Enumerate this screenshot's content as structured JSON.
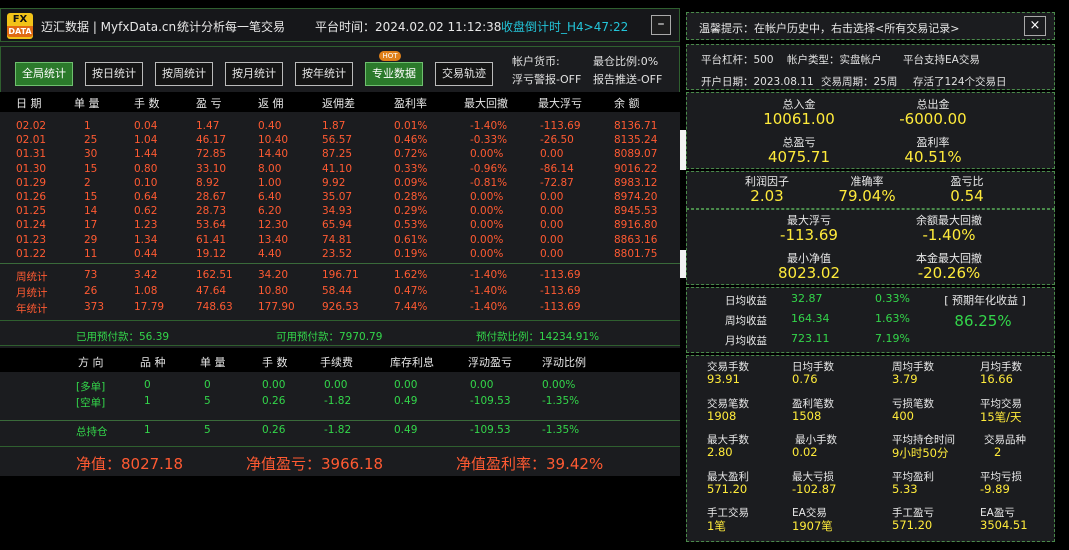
{
  "header": {
    "logo_top": "FX",
    "logo_bottom": "DATA",
    "brand": "迈汇数据 | MyfxData.cn",
    "slogan": "统计分析每一笔交易",
    "platform_time": "平台时间：2024.02.02 11:12:38",
    "countdown": "收盘倒计时_H4>47:22",
    "minimize": "–"
  },
  "toolbar": {
    "buttons": [
      "全局统计",
      "按日统计",
      "按周统计",
      "按月统计",
      "按年统计",
      "专业数据",
      "交易轨迹"
    ],
    "hot_badge": "HOT",
    "account_currency": "帐户货币:",
    "float_alert": "浮亏警报-OFF",
    "max_position": "最仓比例:0%",
    "report_push": "报告推送-OFF"
  },
  "daily_table": {
    "headers": [
      "日 期",
      "单 量",
      "手 数",
      "盈 亏",
      "返 佣",
      "返佣差",
      "盈利率",
      "最大回撤",
      "最大浮亏",
      "余 额"
    ],
    "rows": [
      [
        "02.02",
        "1",
        "0.04",
        "1.47",
        "0.40",
        "1.87",
        "0.01%",
        "-1.40%",
        "-113.69",
        "8136.71"
      ],
      [
        "02.01",
        "25",
        "1.04",
        "46.17",
        "10.40",
        "56.57",
        "0.46%",
        "-0.33%",
        "-26.50",
        "8135.24"
      ],
      [
        "01.31",
        "30",
        "1.44",
        "72.85",
        "14.40",
        "87.25",
        "0.72%",
        "0.00%",
        "0.00",
        "8089.07"
      ],
      [
        "01.30",
        "15",
        "0.80",
        "33.10",
        "8.00",
        "41.10",
        "0.33%",
        "-0.96%",
        "-86.14",
        "9016.22"
      ],
      [
        "01.29",
        "2",
        "0.10",
        "8.92",
        "1.00",
        "9.92",
        "0.09%",
        "-0.81%",
        "-72.87",
        "8983.12"
      ],
      [
        "01.26",
        "15",
        "0.64",
        "28.67",
        "6.40",
        "35.07",
        "0.28%",
        "0.00%",
        "0.00",
        "8974.20"
      ],
      [
        "01.25",
        "14",
        "0.62",
        "28.73",
        "6.20",
        "34.93",
        "0.29%",
        "0.00%",
        "0.00",
        "8945.53"
      ],
      [
        "01.24",
        "17",
        "1.23",
        "53.64",
        "12.30",
        "65.94",
        "0.53%",
        "0.00%",
        "0.00",
        "8916.80"
      ],
      [
        "01.23",
        "29",
        "1.34",
        "61.41",
        "13.40",
        "74.81",
        "0.61%",
        "0.00%",
        "0.00",
        "8863.16"
      ],
      [
        "01.22",
        "11",
        "0.44",
        "19.12",
        "4.40",
        "23.52",
        "0.19%",
        "0.00%",
        "0.00",
        "8801.75"
      ]
    ],
    "summary": [
      [
        "周统计",
        "73",
        "3.42",
        "162.51",
        "34.20",
        "196.71",
        "1.62%",
        "-1.40%",
        "-113.69"
      ],
      [
        "月统计",
        "26",
        "1.08",
        "47.64",
        "10.80",
        "58.44",
        "0.47%",
        "-1.40%",
        "-113.69"
      ],
      [
        "年统计",
        "373",
        "17.79",
        "748.63",
        "177.90",
        "926.53",
        "7.44%",
        "-1.40%",
        "-113.69"
      ]
    ]
  },
  "funds": {
    "used": "已用预付款：56.39",
    "available": "可用预付款：7970.79",
    "ratio": "预付款比例：14234.91%"
  },
  "positions": {
    "headers": [
      "方 向",
      "品 种",
      "单 量",
      "手 数",
      "手续费",
      "库存利息",
      "浮动盈亏",
      "浮动比例"
    ],
    "rows": [
      [
        "[多单]",
        "0",
        "0",
        "0.00",
        "0.00",
        "0.00",
        "0.00",
        "0.00%"
      ],
      [
        "[空单]",
        "1",
        "5",
        "0.26",
        "-1.82",
        "0.49",
        "-109.53",
        "-1.35%"
      ],
      [
        "总持仓",
        "1",
        "5",
        "0.26",
        "-1.82",
        "0.49",
        "-109.53",
        "-1.35%"
      ]
    ]
  },
  "net": {
    "equity": "净值：8027.18",
    "equity_pl": "净值盈亏：3966.18",
    "equity_rate": "净值盈利率：39.42%"
  },
  "right": {
    "tip": "温馨提示：在帐户历史中，右击选择<所有交易记录>",
    "close": "×",
    "info1": [
      "平台杠杆：500",
      "帐户类型：实盘帐户",
      "平台支持EA交易"
    ],
    "info2": [
      "开户日期：2023.08.11",
      "交易周期：25周",
      "存活了124个交易日"
    ],
    "block1": [
      {
        "label": "总入金",
        "value": "10061.00"
      },
      {
        "label": "总出金",
        "value": "-6000.00"
      },
      {
        "label": "总盈亏",
        "value": "4075.71"
      },
      {
        "label": "盈利率",
        "value": "40.51%"
      }
    ],
    "block2": [
      {
        "label": "利润因子",
        "value": "2.03"
      },
      {
        "label": "准确率",
        "value": "79.04%"
      },
      {
        "label": "盈亏比",
        "value": "0.54"
      }
    ],
    "block3": [
      {
        "label": "最大浮亏",
        "value": "-113.69"
      },
      {
        "label": "余额最大回撤",
        "value": "-1.40%"
      },
      {
        "label": "最小净值",
        "value": "8023.02"
      },
      {
        "label": "本金最大回撤",
        "value": "-20.26%"
      }
    ],
    "yields": [
      {
        "label": "日均收益",
        "amount": "32.87",
        "pct": "0.33%"
      },
      {
        "label": "周均收益",
        "amount": "164.34",
        "pct": "1.63%"
      },
      {
        "label": "月均收益",
        "amount": "723.11",
        "pct": "7.19%"
      }
    ],
    "annual_label": "[ 预期年化收益 ]",
    "annual_value": "86.25%",
    "stats": [
      [
        {
          "label": "交易手数",
          "value": "93.91"
        },
        {
          "label": "日均手数",
          "value": "0.76"
        },
        {
          "label": "周均手数",
          "value": "3.79"
        },
        {
          "label": "月均手数",
          "value": "16.66"
        }
      ],
      [
        {
          "label": "交易笔数",
          "value": "1908"
        },
        {
          "label": "盈利笔数",
          "value": "1508"
        },
        {
          "label": "亏损笔数",
          "value": "400"
        },
        {
          "label": "平均交易",
          "value": "15笔/天"
        }
      ],
      [
        {
          "label": "最大手数",
          "value": "2.80"
        },
        {
          "label": "最小手数",
          "value": "0.02"
        },
        {
          "label": "平均持仓时间",
          "value": "9小时50分"
        },
        {
          "label": "交易品种",
          "value": "2"
        }
      ],
      [
        {
          "label": "最大盈利",
          "value": "571.20"
        },
        {
          "label": "最大亏损",
          "value": "-102.87"
        },
        {
          "label": "平均盈利",
          "value": "5.33"
        },
        {
          "label": "平均亏损",
          "value": "-9.89"
        }
      ],
      [
        {
          "label": "手工交易",
          "value": "1笔"
        },
        {
          "label": "EA交易",
          "value": "1907笔"
        },
        {
          "label": "手工盈亏",
          "value": "571.20"
        },
        {
          "label": "EA盈亏",
          "value": "3504.51"
        }
      ]
    ]
  }
}
